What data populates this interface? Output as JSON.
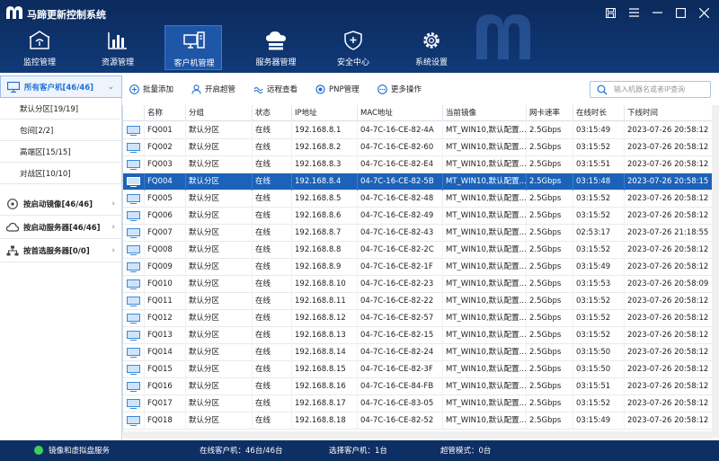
{
  "app": {
    "title": "马蹄更新控制系统"
  },
  "nav": [
    {
      "label": "监控管理",
      "icon": "monitor-home-icon"
    },
    {
      "label": "资源管理",
      "icon": "bar-chart-icon"
    },
    {
      "label": "客户机管理",
      "icon": "computers-icon",
      "active": true
    },
    {
      "label": "服务器管理",
      "icon": "cloud-server-icon"
    },
    {
      "label": "安全中心",
      "icon": "shield-icon"
    },
    {
      "label": "系统设置",
      "icon": "gear-icon"
    }
  ],
  "sidebar": {
    "groups": [
      {
        "label": "所有客户机[46/46]",
        "icon": "monitor-icon",
        "active": true
      },
      {
        "label": "按启动镜像[46/46]",
        "icon": "disk-icon"
      },
      {
        "label": "按启动服务器[46/46]",
        "icon": "cloud-icon"
      },
      {
        "label": "按首选服务器[0/0]",
        "icon": "network-icon"
      }
    ],
    "subitems": [
      "默认分区[19/19]",
      "包间[2/2]",
      "高端区[15/15]",
      "对战区[10/10]"
    ]
  },
  "toolbar": {
    "buttons": [
      {
        "label": "批量添加",
        "icon": "plus-circle-icon"
      },
      {
        "label": "开启超管",
        "icon": "user-icon"
      },
      {
        "label": "远程查看",
        "icon": "remote-view-icon"
      },
      {
        "label": "PNP管理",
        "icon": "pnp-icon"
      },
      {
        "label": "更多操作",
        "icon": "more-icon"
      }
    ],
    "search_placeholder": "输入机器名或者IP查询"
  },
  "table": {
    "columns": [
      "名称",
      "分组",
      "状态",
      "IP地址",
      "MAC地址",
      "当前镜像",
      "网卡速率",
      "在线时长",
      "下线时间"
    ],
    "rows": [
      [
        "FQ001",
        "默认分区",
        "在线",
        "192.168.8.1",
        "04-7C-16-CE-82-4A",
        "MT_WIN10,默认配置...",
        "2.5Gbps",
        "03:15:49",
        "2023-07-26 20:58:12"
      ],
      [
        "FQ002",
        "默认分区",
        "在线",
        "192.168.8.2",
        "04-7C-16-CE-82-60",
        "MT_WIN10,默认配置...",
        "2.5Gbps",
        "03:15:52",
        "2023-07-26 20:58:12"
      ],
      [
        "FQ003",
        "默认分区",
        "在线",
        "192.168.8.3",
        "04-7C-16-CE-82-E4",
        "MT_WIN10,默认配置...",
        "2.5Gbps",
        "03:15:51",
        "2023-07-26 20:58:12"
      ],
      [
        "FQ004",
        "默认分区",
        "在线",
        "192.168.8.4",
        "04-7C-16-CE-82-5B",
        "MT_WIN10,默认配置...",
        "2.5Gbps",
        "03:15:48",
        "2023-07-26 20:58:15"
      ],
      [
        "FQ005",
        "默认分区",
        "在线",
        "192.168.8.5",
        "04-7C-16-CE-82-48",
        "MT_WIN10,默认配置...",
        "2.5Gbps",
        "03:15:52",
        "2023-07-26 20:58:12"
      ],
      [
        "FQ006",
        "默认分区",
        "在线",
        "192.168.8.6",
        "04-7C-16-CE-82-49",
        "MT_WIN10,默认配置...",
        "2.5Gbps",
        "03:15:52",
        "2023-07-26 20:58:12"
      ],
      [
        "FQ007",
        "默认分区",
        "在线",
        "192.168.8.7",
        "04-7C-16-CE-82-43",
        "MT_WIN10,默认配置...",
        "2.5Gbps",
        "02:53:17",
        "2023-07-26 21:18:55"
      ],
      [
        "FQ008",
        "默认分区",
        "在线",
        "192.168.8.8",
        "04-7C-16-CE-82-2C",
        "MT_WIN10,默认配置...",
        "2.5Gbps",
        "03:15:52",
        "2023-07-26 20:58:12"
      ],
      [
        "FQ009",
        "默认分区",
        "在线",
        "192.168.8.9",
        "04-7C-16-CE-82-1F",
        "MT_WIN10,默认配置...",
        "2.5Gbps",
        "03:15:49",
        "2023-07-26 20:58:12"
      ],
      [
        "FQ010",
        "默认分区",
        "在线",
        "192.168.8.10",
        "04-7C-16-CE-82-23",
        "MT_WIN10,默认配置...",
        "2.5Gbps",
        "03:15:53",
        "2023-07-26 20:58:09"
      ],
      [
        "FQ011",
        "默认分区",
        "在线",
        "192.168.8.11",
        "04-7C-16-CE-82-22",
        "MT_WIN10,默认配置...",
        "2.5Gbps",
        "03:15:52",
        "2023-07-26 20:58:12"
      ],
      [
        "FQ012",
        "默认分区",
        "在线",
        "192.168.8.12",
        "04-7C-16-CE-82-57",
        "MT_WIN10,默认配置...",
        "2.5Gbps",
        "03:15:52",
        "2023-07-26 20:58:12"
      ],
      [
        "FQ013",
        "默认分区",
        "在线",
        "192.168.8.13",
        "04-7C-16-CE-82-15",
        "MT_WIN10,默认配置...",
        "2.5Gbps",
        "03:15:52",
        "2023-07-26 20:58:12"
      ],
      [
        "FQ014",
        "默认分区",
        "在线",
        "192.168.8.14",
        "04-7C-16-CE-82-24",
        "MT_WIN10,默认配置...",
        "2.5Gbps",
        "03:15:50",
        "2023-07-26 20:58:12"
      ],
      [
        "FQ015",
        "默认分区",
        "在线",
        "192.168.8.15",
        "04-7C-16-CE-82-3F",
        "MT_WIN10,默认配置...",
        "2.5Gbps",
        "03:15:50",
        "2023-07-26 20:58:12"
      ],
      [
        "FQ016",
        "默认分区",
        "在线",
        "192.168.8.16",
        "04-7C-16-CE-84-FB",
        "MT_WIN10,默认配置...",
        "2.5Gbps",
        "03:15:51",
        "2023-07-26 20:58:12"
      ],
      [
        "FQ017",
        "默认分区",
        "在线",
        "192.168.8.17",
        "04-7C-16-CE-83-05",
        "MT_WIN10,默认配置...",
        "2.5Gbps",
        "03:15:52",
        "2023-07-26 20:58:12"
      ],
      [
        "FQ018",
        "默认分区",
        "在线",
        "192.168.8.18",
        "04-7C-16-CE-82-52",
        "MT_WIN10,默认配置...",
        "2.5Gbps",
        "03:15:49",
        "2023-07-26 20:58:12"
      ]
    ],
    "selected_row": 3
  },
  "status": {
    "service": "镜像和虚拟盘服务",
    "online": "在线客户机：46台/46台",
    "selected": "选择客户机：1台",
    "supermode": "超管模式：0台"
  },
  "colors": {
    "header_bg": "#0c2a5c",
    "selected_row": "#1c62b9",
    "accent": "#1e6fd0",
    "status_ok": "#3dd05a"
  }
}
